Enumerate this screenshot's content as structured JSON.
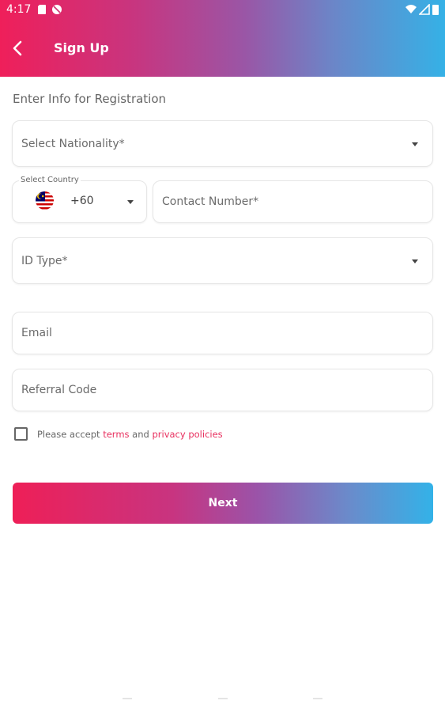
{
  "status_bar": {
    "time": "4:17"
  },
  "appbar": {
    "title": "Sign Up"
  },
  "form": {
    "intro": "Enter Info for Registration",
    "nationality_placeholder": "Select Nationality*",
    "country_label": "Select Country",
    "country_code": "+60",
    "contact_placeholder": "Contact Number*",
    "id_type_placeholder": "ID Type*",
    "email_placeholder": "Email",
    "referral_placeholder": "Referral Code",
    "accept_prefix": "Please accept ",
    "terms_link": "terms",
    "accept_and": " and ",
    "privacy_link": "privacy policies",
    "next_label": "Next"
  },
  "colors": {
    "gradient_start": "#ef1f5a",
    "gradient_end": "#35b1e6",
    "link": "#e8305f"
  }
}
